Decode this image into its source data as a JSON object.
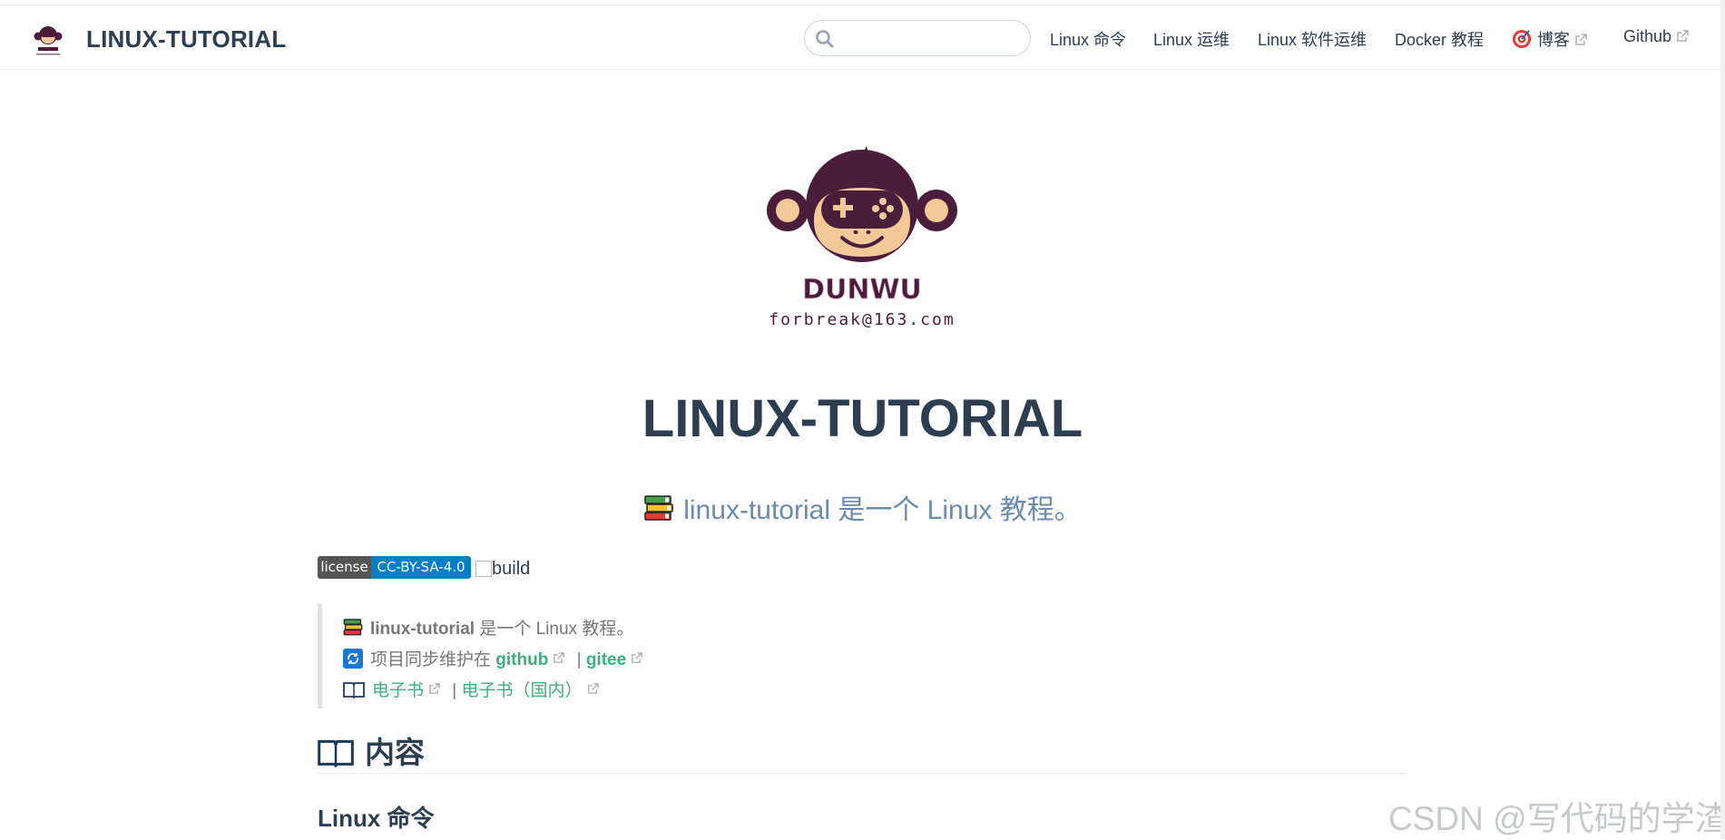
{
  "navbar": {
    "site_name": "LINUX-TUTORIAL",
    "search": {
      "placeholder": "",
      "value": ""
    },
    "links": [
      {
        "label": "Linux 命令",
        "external": false
      },
      {
        "label": "Linux 运维",
        "external": false
      },
      {
        "label": "Linux 软件运维",
        "external": false
      },
      {
        "label": "Docker 教程",
        "external": false
      },
      {
        "label": "博客",
        "external": true
      },
      {
        "label": "Github",
        "external": true
      }
    ]
  },
  "logo": {
    "brand": "DUNWU",
    "email": "forbreak@163.com"
  },
  "hero": {
    "title": "LINUX-TUTORIAL",
    "description": "linux-tutorial 是一个 Linux 教程。"
  },
  "badges": {
    "license_label": "license",
    "license_value": "CC-BY-SA-4.0",
    "build_alt": "build"
  },
  "blockquote": {
    "line1_name": "linux-tutorial",
    "line1_text": " 是一个 Linux 教程。",
    "line2_text": "项目同步维护在 ",
    "github_link": "github",
    "separator": " | ",
    "gitee_link": "gitee",
    "ebook_link": "电子书",
    "ebook_cn_link": "电子书（国内）"
  },
  "content": {
    "section_title": "内容",
    "subsection_title": "Linux 命令"
  },
  "watermark": "CSDN @写代码的学渣",
  "colors": {
    "text": "#2c3e50",
    "accent": "#3eaf7c",
    "description": "#6a8bad",
    "badge_left": "#555555",
    "badge_right": "#007ec6",
    "monkey": "#4a1e3b"
  }
}
